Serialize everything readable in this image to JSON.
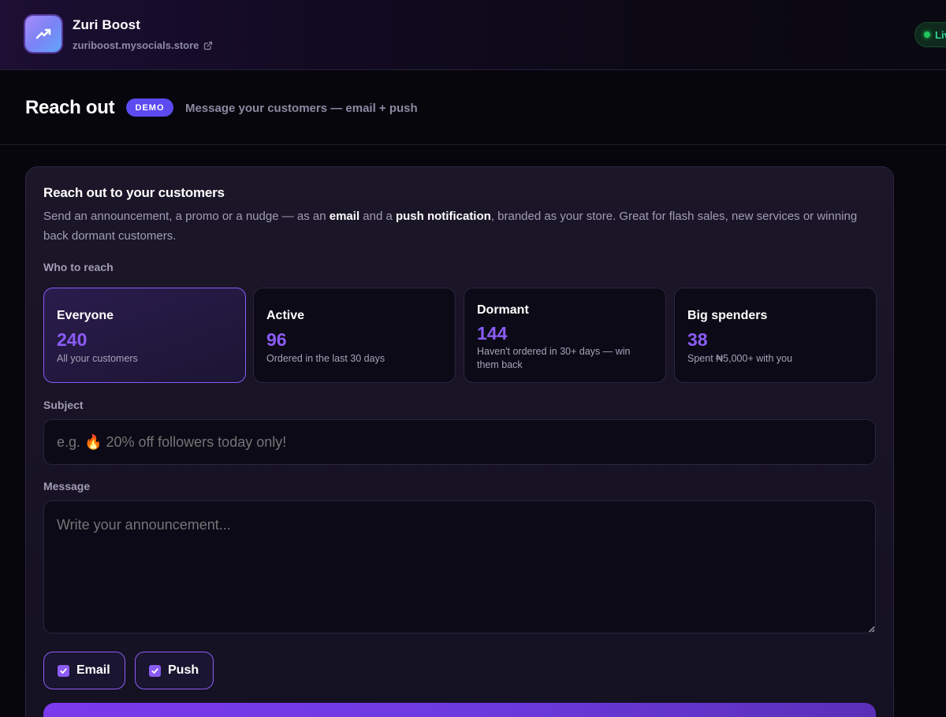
{
  "header": {
    "brand_name": "Zuri Boost",
    "brand_url": "zuriboost.mysocials.store",
    "status_label": "Live",
    "status_color": "#22c55e",
    "logo_icon": "trending-up-icon",
    "url_icon": "external-link-icon"
  },
  "page": {
    "title": "Reach out",
    "badge": "DEMO",
    "subtitle": "Message your customers — email + push"
  },
  "card": {
    "title": "Reach out to your customers",
    "desc_part1": "Send an announcement, a promo or a nudge — as an ",
    "desc_email": "email",
    "desc_part2": " and a ",
    "desc_push": "push notification",
    "desc_part3": ", branded as your store. Great for flash sales, new services or winning back dormant customers.",
    "who_label": "Who to reach",
    "segments": [
      {
        "name": "Everyone",
        "count": "240",
        "desc": "All your customers",
        "selected": true
      },
      {
        "name": "Active",
        "count": "96",
        "desc": "Ordered in the last 30 days",
        "selected": false
      },
      {
        "name": "Dormant",
        "count": "144",
        "desc": "Haven't ordered in 30+ days — win them back",
        "selected": false
      },
      {
        "name": "Big spenders",
        "count": "38",
        "desc": "Spent ₦5,000+ with you",
        "selected": false
      }
    ],
    "subject_label": "Subject",
    "subject_placeholder": "e.g. 🔥 20% off followers today only!",
    "subject_value": "",
    "message_label": "Message",
    "message_placeholder": "Write your announcement...",
    "message_value": "",
    "channels": [
      {
        "label": "Email",
        "checked": true
      },
      {
        "label": "Push",
        "checked": true
      }
    ]
  },
  "colors": {
    "accent": "#8b5cf6",
    "badge": "#5b4bf0",
    "background": "#07060d"
  }
}
